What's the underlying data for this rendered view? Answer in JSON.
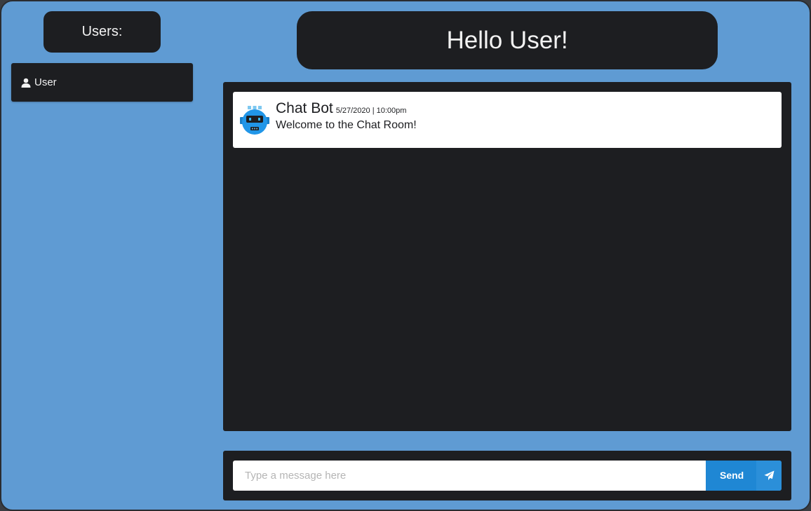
{
  "sidebar": {
    "title": "Users:",
    "users": [
      {
        "name": "User",
        "icon": "user-icon"
      }
    ]
  },
  "header": {
    "greeting": "Hello User!"
  },
  "chat": {
    "messages": [
      {
        "author": "Chat Bot",
        "timestamp": "5/27/2020 | 10:00pm",
        "text": "Welcome to the Chat Room!",
        "avatar_icon": "robot-icon"
      }
    ]
  },
  "compose": {
    "placeholder": "Type a message here",
    "value": "",
    "send_label": "Send",
    "send_icon": "paper-plane-icon"
  },
  "colors": {
    "background": "#5f9bd3",
    "panel": "#1d1e21",
    "accent": "#1f87d4",
    "text_light": "#f2f2f2"
  }
}
